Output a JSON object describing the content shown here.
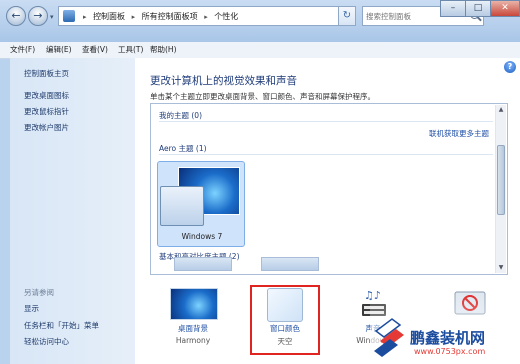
{
  "address_bar": {
    "crumbs": [
      "控制面板",
      "所有控制面板项",
      "个性化"
    ]
  },
  "search": {
    "placeholder": "搜索控制面板"
  },
  "menu": [
    "文件(F)",
    "编辑(E)",
    "查看(V)",
    "工具(T)",
    "帮助(H)"
  ],
  "sidebar": {
    "home": "控制面板主页",
    "links": [
      "更改桌面图标",
      "更改鼠标指针",
      "更改帐户图片"
    ],
    "see_also_heading": "另请参阅",
    "see_also": [
      "显示",
      "任务栏和「开始」菜单",
      "轻松访问中心"
    ]
  },
  "main": {
    "heading": "更改计算机上的视觉效果和声音",
    "subtitle": "单击某个主题立即更改桌面背景、窗口颜色、声音和屏幕保护程序。",
    "my_themes": "我的主题 (0)",
    "online_link": "联机获取更多主题",
    "aero_group": "Aero 主题 (1)",
    "theme_name": "Windows 7",
    "basic_group": "基本和高对比度主题 (2)"
  },
  "bottom": {
    "desktop_bg_label": "桌面背景",
    "desktop_bg_value": "Harmony",
    "window_color_label": "窗口颜色",
    "window_color_value": "天空",
    "sound_label": "声音",
    "sound_value": "Windows"
  },
  "watermark": {
    "name": "鹏鑫装机网",
    "url": "www.0753px.com"
  },
  "colors": {
    "accent_link": "#1f4fa5",
    "heading": "#1e3b7a",
    "highlight_border": "#e0241f"
  }
}
